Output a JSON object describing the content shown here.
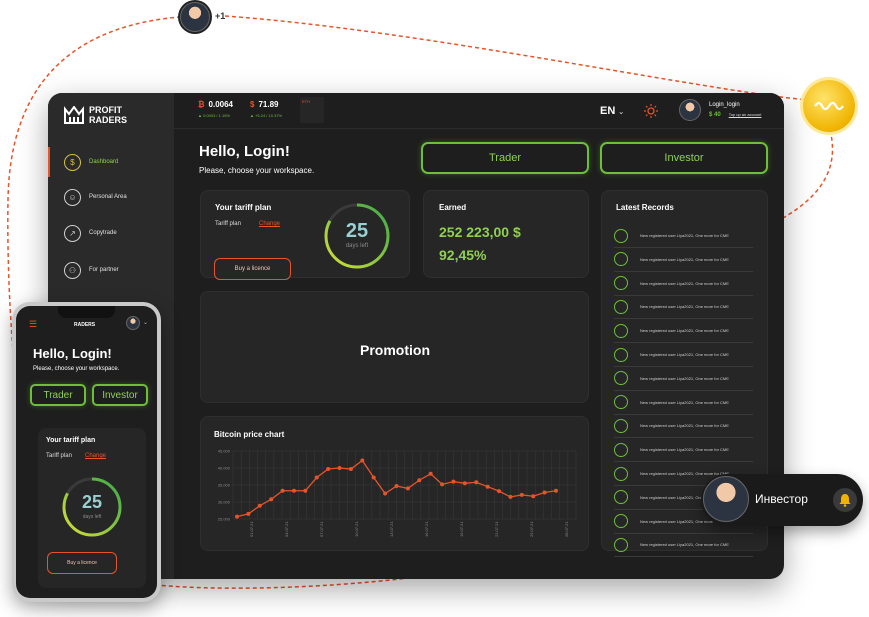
{
  "brand": {
    "line1": "PROFIT",
    "line2": "RADERS",
    "mobile_name": "RADERS"
  },
  "sidebar": {
    "items": [
      {
        "label": "Dashboard",
        "icon": "dollar-icon",
        "active": true
      },
      {
        "label": "Personal Area",
        "icon": "user-icon"
      },
      {
        "label": "Copytrade",
        "icon": "trend-icon"
      },
      {
        "label": "For partner",
        "icon": "partners-icon"
      }
    ]
  },
  "topbar": {
    "tickers": [
      {
        "symbol": "₿",
        "value": "0.0064",
        "change": "▲ 0.0003 / 1.15%"
      },
      {
        "symbol": "$",
        "value": "71.89",
        "change": "▲ +5.24 / 10.37%"
      }
    ],
    "third_label": "ETH",
    "language": "EN",
    "user": {
      "name": "Login_login",
      "balance": "$ 40",
      "topup": "Top up an account"
    }
  },
  "greeting": {
    "title": "Hello, Login!",
    "subtitle": "Please, choose your workspace."
  },
  "workspace": {
    "trader": "Trader",
    "investor": "Investor"
  },
  "tariff": {
    "title": "Your tariff plan",
    "label": "Tariff plan",
    "change": "Change",
    "days": "25",
    "days_label": "days left",
    "buy": "Buy a licence",
    "progress": 0.83
  },
  "earned": {
    "title": "Earned",
    "amount": "252 223,00 $",
    "percent": "92,45%"
  },
  "promotion": {
    "label": "Promotion"
  },
  "latest_records": {
    "title": "Latest Records",
    "text": "New registered user Liya2021, One more for CME",
    "count": 14
  },
  "chart_data": {
    "type": "line",
    "title": "Bitcoin price chart",
    "yticks": [
      "25,000",
      "30,000",
      "35,000",
      "40,000",
      "45,000"
    ],
    "ylim": [
      25000,
      45000
    ],
    "xticks": [
      "01.07.21",
      "04.07.21",
      "07.07.21",
      "10.07.21",
      "13.07.21",
      "16.07.21",
      "19.07.21",
      "22.07.21",
      "25.07.21",
      "28.07.21"
    ],
    "values": [
      25700,
      26500,
      28900,
      30800,
      33300,
      33300,
      33300,
      37200,
      39700,
      40000,
      39700,
      42200,
      37200,
      32500,
      34700,
      34000,
      36400,
      38300,
      35200,
      36000,
      35500,
      35800,
      34500,
      33200,
      31500,
      32100,
      31700,
      32800,
      33300
    ],
    "color": "#e8542a",
    "grid": true
  },
  "mobile": {
    "hello": "Hello, Login!",
    "subtitle": "Please, choose your workspace.",
    "trader": "Trader",
    "investor": "Investor",
    "tariff_title": "Your tariff plan",
    "tariff_label": "Tariff plan",
    "change": "Change",
    "days": "25",
    "days_label": "days left",
    "buy": "Buy a licence"
  },
  "floating": {
    "plus": "+1",
    "investor_name": "Инвестор"
  },
  "colors": {
    "accent_green": "#6dbf3a",
    "accent_orange": "#e8542a",
    "background": "#1e1e1e"
  }
}
